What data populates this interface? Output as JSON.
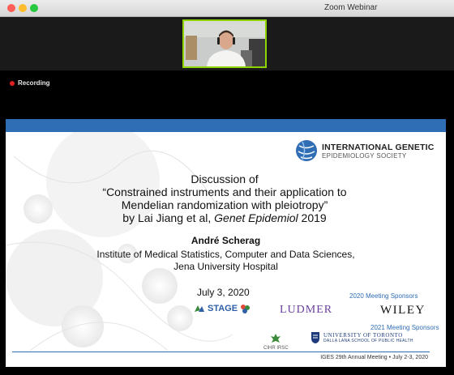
{
  "window": {
    "title": "Zoom Webinar"
  },
  "status": {
    "recording_label": "Recording"
  },
  "slide": {
    "society_line1": "INTERNATIONAL GENETIC",
    "society_line2": "EPIDEMIOLOGY SOCIETY",
    "title_line1": "Discussion of",
    "title_line2": "“Constrained instruments and their application to",
    "title_line3": "Mendelian randomization with pleiotropy”",
    "title_line4_prefix": "by Lai Jiang et al, ",
    "title_line4_journal": "Genet Epidemiol",
    "title_line4_year": " 2019",
    "author": "André Scherag",
    "institute_line1": "Institute of Medical Statistics, Computer and Data Sciences,",
    "institute_line2": "Jena University Hospital",
    "date": "July 3, 2020",
    "sponsors_2020_heading": "2020 Meeting Sponsors",
    "sponsors_2021_heading": "2021 Meeting Sponsors",
    "sponsor_stage": "STAGE",
    "sponsor_ludmer": "LUDMER",
    "sponsor_wiley": "WILEY",
    "sponsor_cihr": "CIHR IRSC",
    "sponsor_uoft_line1": "UNIVERSITY OF TORONTO",
    "sponsor_uoft_line2": "DALLA LANA SCHOOL OF PUBLIC HEALTH",
    "footer": "IGES 29th Annual Meeting • July 2-3, 2020"
  },
  "colors": {
    "accent_blue": "#2f6db5",
    "speaker_highlight": "#8fd400",
    "recording_red": "#e02020"
  }
}
